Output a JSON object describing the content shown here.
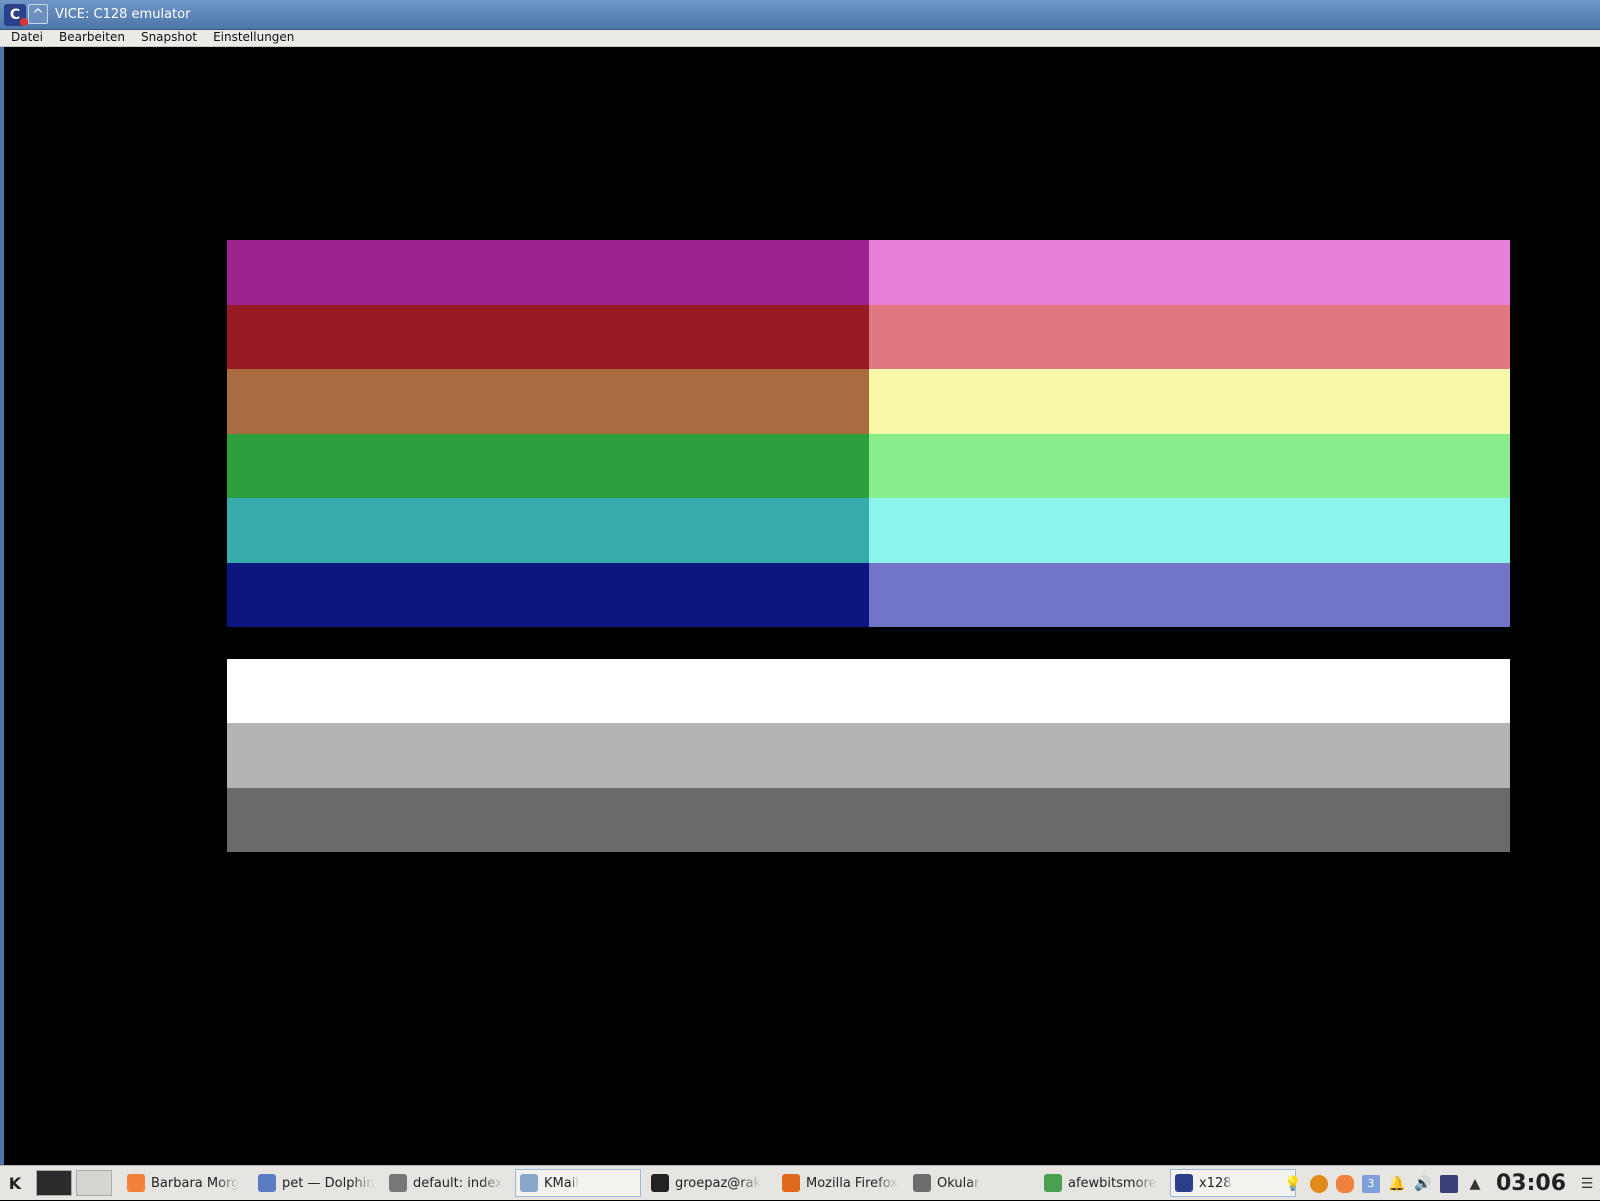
{
  "window": {
    "title": "VICE: C128 emulator",
    "shade_glyph": "^",
    "app_icon_glyph": "C"
  },
  "menubar": {
    "items": [
      "Datei",
      "Bearbeiten",
      "Snapshot",
      "Einstellungen"
    ]
  },
  "palette": {
    "upper_rows": [
      [
        "#9c2490",
        "#e680d8"
      ],
      [
        "#981a24",
        "#e07880"
      ],
      [
        "#a86c40",
        "#f8f8a8"
      ],
      [
        "#2ca03c",
        "#88ec8c"
      ],
      [
        "#38acac",
        "#8cf4ec"
      ],
      [
        "#0c1680",
        "#7274c8"
      ]
    ],
    "lower_rows": [
      "#ffffff",
      "#b4b4b4",
      "#6a6a6a"
    ]
  },
  "taskbar": {
    "kmenu_glyph": "K",
    "tasks": [
      {
        "label": "Barbara Morg",
        "icon_color": "#f0803c",
        "active": false
      },
      {
        "label": "pet — Dolphin",
        "icon_color": "#5a7cc2",
        "active": false
      },
      {
        "label": "default: index",
        "icon_color": "#777777",
        "active": false
      },
      {
        "label": "KMail",
        "icon_color": "#8aa6c8",
        "active": true
      },
      {
        "label": "groepaz@rak",
        "icon_color": "#222222",
        "active": false
      },
      {
        "label": "Mozilla Firefox",
        "icon_color": "#e06a1c",
        "active": false
      },
      {
        "label": "Okular",
        "icon_color": "#6d6d6d",
        "active": false
      },
      {
        "label": "afewbitsmore",
        "icon_color": "#4aa050",
        "active": false
      },
      {
        "label": "x128",
        "icon_color": "#2c3f8a",
        "active": true
      }
    ],
    "tray": {
      "icons": [
        "lightbulb-icon",
        "radioactive-icon",
        "mail-icon",
        "mail-count-icon",
        "bell-icon",
        "volume-icon",
        "monitor-icon",
        "expand-tray-icon"
      ],
      "mail_count": "3",
      "clock": "03:06",
      "menu_glyph": "☰"
    }
  }
}
